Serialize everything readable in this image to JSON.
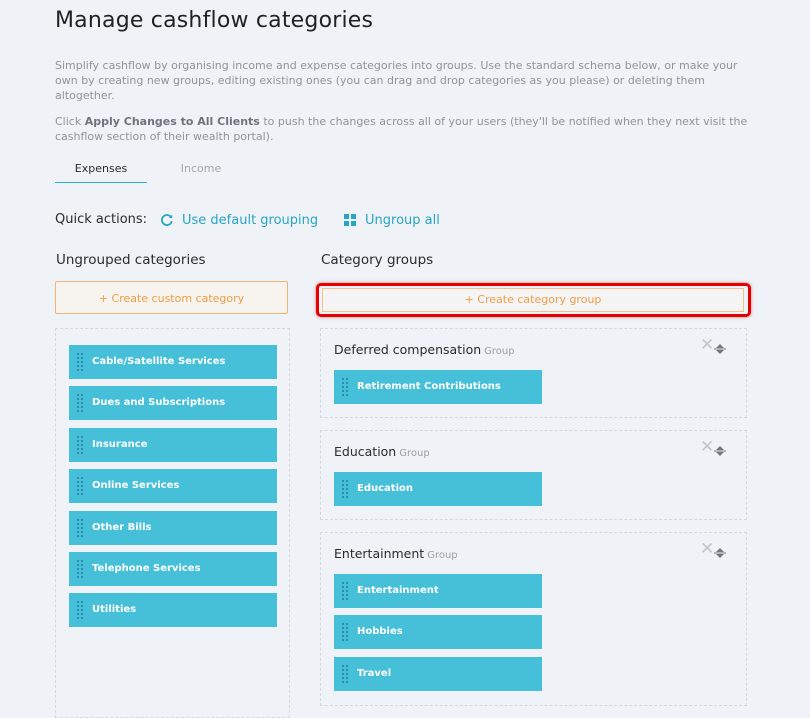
{
  "page": {
    "title": "Manage cashflow categories",
    "intro_1": "Simplify cashflow by organising income and expense categories into groups. Use the standard schema below, or make your own by creating new groups, editing existing ones (you can drag and drop categories as you please) or deleting them altogether.",
    "intro_2_prefix": "Click ",
    "intro_2_bold": "Apply Changes to All Clients",
    "intro_2_suffix": " to push the changes across all of your users (they'll be notified when they next visit the cashflow section of their wealth portal)."
  },
  "tabs": [
    {
      "label": "Expenses",
      "active": true
    },
    {
      "label": "Income",
      "active": false
    }
  ],
  "quick_actions": {
    "label": "Quick actions:",
    "default_grouping": {
      "label": "Use default grouping",
      "icon": "refresh-icon"
    },
    "ungroup_all": {
      "label": "Ungroup all",
      "icon": "grid-icon"
    }
  },
  "ungrouped": {
    "heading": "Ungrouped categories",
    "create_label": "+ Create custom category",
    "items": [
      "Cable/Satellite Services",
      "Dues and Subscriptions",
      "Insurance",
      "Online Services",
      "Other Bills",
      "Telephone Services",
      "Utilities"
    ]
  },
  "groups": {
    "heading": "Category groups",
    "create_label": "+ Create category group",
    "suffix": "Group",
    "list": [
      {
        "name": "Deferred compensation",
        "items": [
          "Retirement Contributions"
        ]
      },
      {
        "name": "Education",
        "items": [
          "Education"
        ]
      },
      {
        "name": "Entertainment",
        "items": [
          "Entertainment",
          "Hobbies",
          "Travel"
        ]
      }
    ]
  },
  "colors": {
    "accent": "#27b4d2",
    "category_tile": "#46bfd9",
    "create_button": "#ee9d45",
    "highlight": "#e20000"
  }
}
